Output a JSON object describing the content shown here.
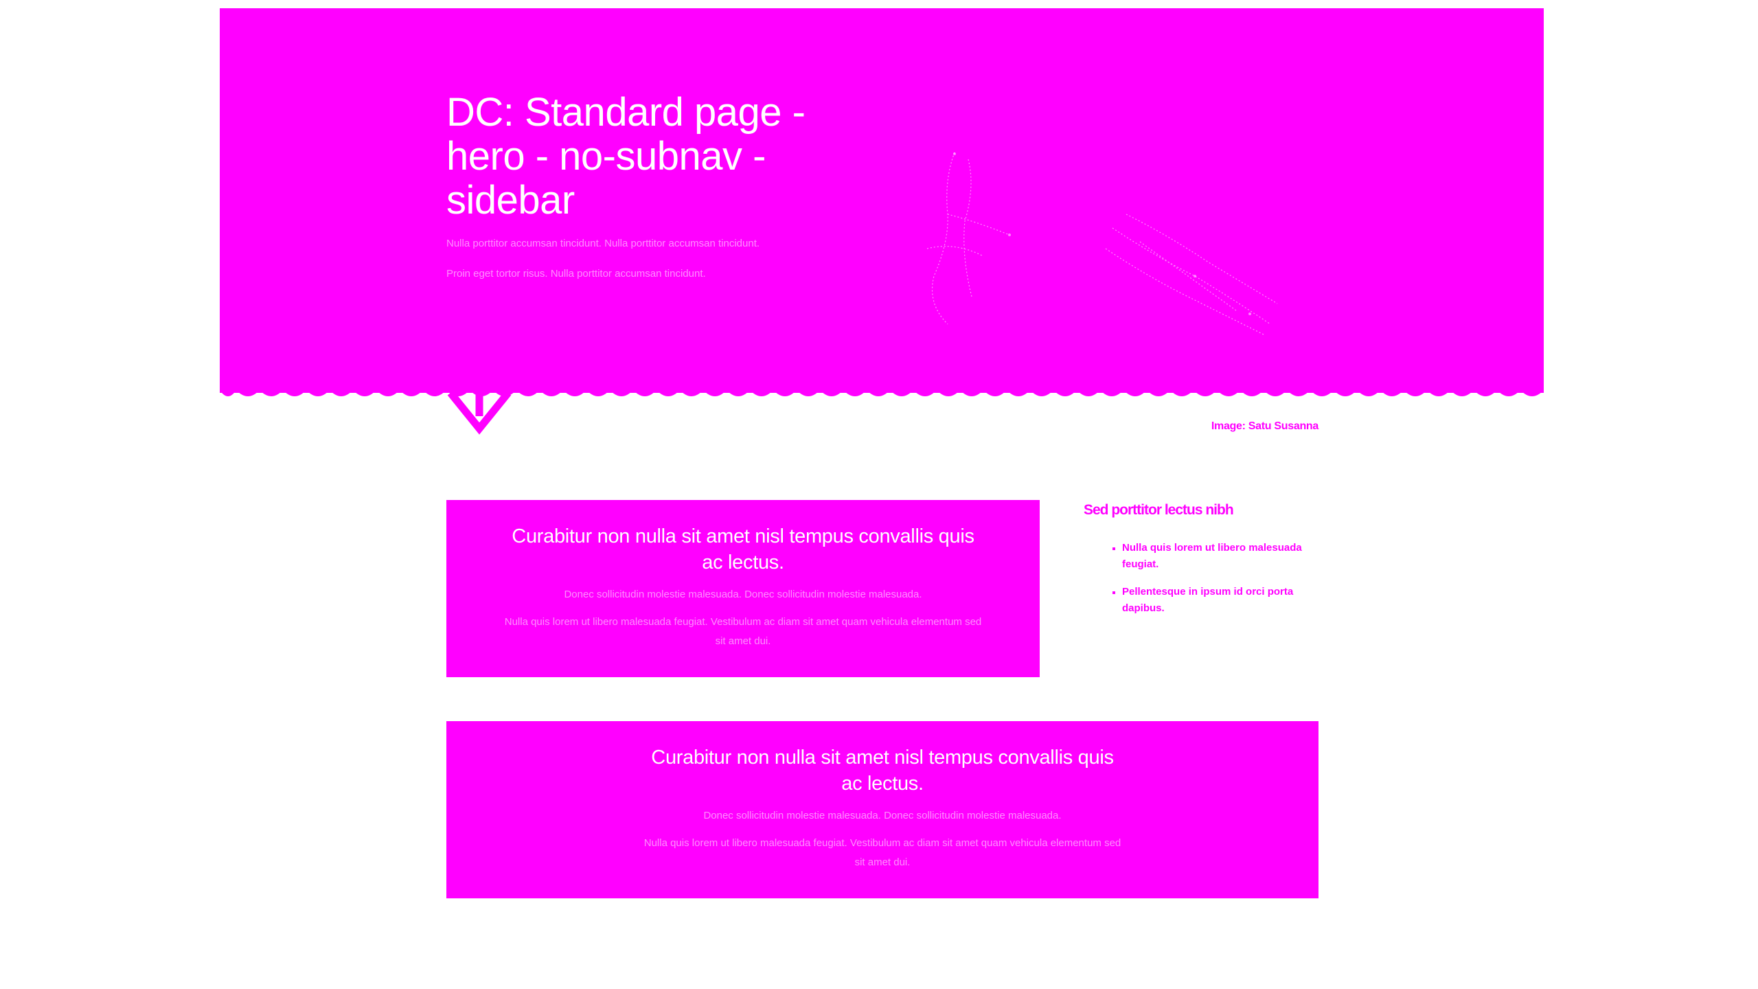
{
  "hero": {
    "title": "DC: Standard page - hero - no-subnav - sidebar",
    "paragraphs": [
      "Nulla porttitor accumsan tincidunt. Nulla porttitor accumsan tincidunt.",
      "Proin eget tortor risus. Nulla porttitor accumsan tincidunt."
    ],
    "image_credit": "Image: Satu Susanna",
    "scroll_icon": "chevron-down-icon"
  },
  "main": {
    "cards": [
      {
        "heading": "Curabitur non nulla sit amet nisl tempus convallis quis ac lectus.",
        "paragraphs": [
          "Donec sollicitudin molestie malesuada. Donec sollicitudin molestie malesuada.",
          "Nulla quis lorem ut libero malesuada feugiat. Vestibulum ac diam sit amet quam vehicula elementum sed sit amet dui."
        ]
      },
      {
        "heading": "Curabitur non nulla sit amet nisl tempus convallis quis ac lectus.",
        "paragraphs": [
          "Donec sollicitudin molestie malesuada. Donec sollicitudin molestie malesuada.",
          "Nulla quis lorem ut libero malesuada feugiat. Vestibulum ac diam sit amet quam vehicula elementum sed sit amet dui."
        ]
      }
    ]
  },
  "sidebar": {
    "title": "Sed porttitor lectus nibh",
    "items": [
      "Nulla quis lorem ut libero malesuada feugiat.",
      "Pellentesque in ipsum id orci porta dapibus."
    ]
  },
  "colors": {
    "brand": "#ff00ff",
    "text_on_brand": "#ffffff",
    "background": "#ffffff"
  }
}
